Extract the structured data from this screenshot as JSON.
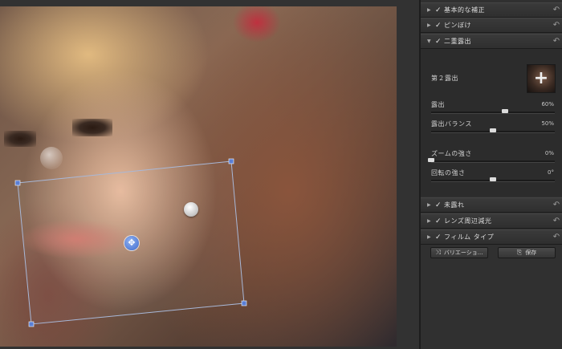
{
  "panel": {
    "sections": [
      {
        "label": "基本的な補正",
        "checked": "✓",
        "expanded": false
      },
      {
        "label": "ピンぼけ",
        "checked": "✓",
        "expanded": false
      },
      {
        "label": "二重露出",
        "checked": "✓",
        "expanded": true
      },
      {
        "label": "未露れ",
        "checked": "✓",
        "expanded": false
      },
      {
        "label": "レンズ周辺減光",
        "checked": "✓",
        "expanded": false
      },
      {
        "label": "フィルム タイプ",
        "checked": "✓",
        "expanded": false
      }
    ],
    "double_exposure": {
      "title": "第２露出",
      "sliders": [
        {
          "label": "露出",
          "value": "60%",
          "position": 0.6
        },
        {
          "label": "露出バランス",
          "value": "50%",
          "position": 0.5
        },
        {
          "label": "ズームの強さ",
          "value": "0%",
          "position": 0.0
        },
        {
          "label": "回転の強さ",
          "value": "0°",
          "position": 0.5
        }
      ]
    },
    "buttons": {
      "variations": "バリエーショ...",
      "save": "保存"
    }
  },
  "colors": {
    "accent_handle": "#3f6ccf",
    "panel_bg": "#303030"
  },
  "icons": {
    "expand": "triangle-right-icon",
    "reset": "undo-arrow-icon",
    "move_handle": "move-arrows-icon",
    "rotate_handle": "rotate-handle-icon",
    "add": "plus-icon"
  }
}
